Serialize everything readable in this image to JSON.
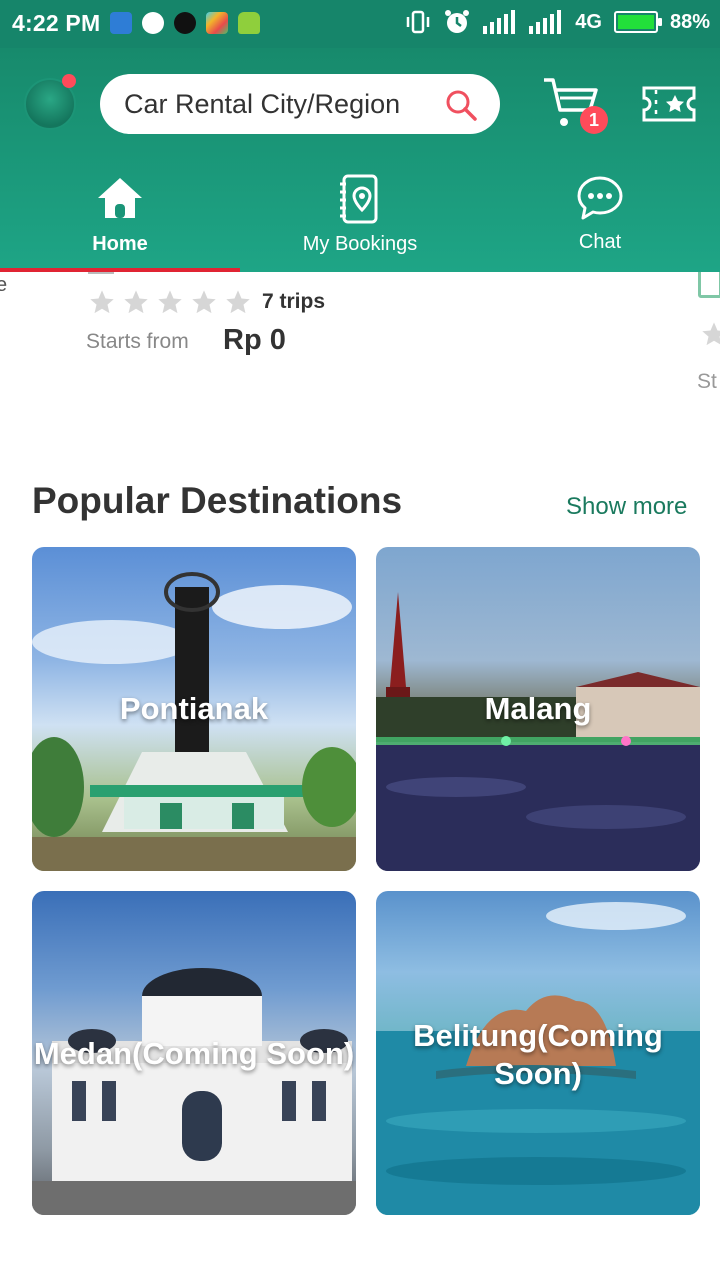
{
  "status_bar": {
    "time": "4:22 PM",
    "network": "4G",
    "battery": "88%"
  },
  "header": {
    "search_placeholder": "Car Rental City/Region",
    "cart_badge": "1"
  },
  "tabs": [
    {
      "label": "Home",
      "active": true
    },
    {
      "label": "My Bookings",
      "active": false
    },
    {
      "label": "Chat",
      "active": false
    }
  ],
  "partial_listing": {
    "trips": "7 trips",
    "starts_from_label": "Starts from",
    "price": "Rp 0",
    "edge_left_text": "e",
    "edge_right_text": "St"
  },
  "popular": {
    "title": "Popular Destinations",
    "show_more": "Show more",
    "destinations": [
      {
        "name": "Pontianak"
      },
      {
        "name": "Malang"
      },
      {
        "name": "Medan(Coming Soon)"
      },
      {
        "name": "Belitung(Coming Soon)"
      }
    ]
  },
  "colors": {
    "brand": "#16856a",
    "accent": "#e02433",
    "badge": "#ff4b5a"
  }
}
